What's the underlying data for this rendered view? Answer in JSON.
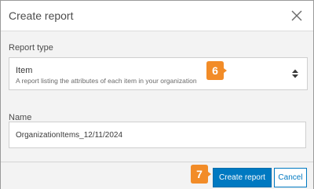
{
  "dialog": {
    "title": "Create report",
    "close_icon": "close-icon"
  },
  "report_type": {
    "label": "Report type",
    "selected_title": "Item",
    "selected_description": "A report listing the attributes of each item in your organization",
    "arrows_icon": "chevron-up-down-icon"
  },
  "name": {
    "label": "Name",
    "value": "OrganizationItems_12/11/2024"
  },
  "footer": {
    "create_label": "Create report",
    "cancel_label": "Cancel"
  },
  "callouts": {
    "report_type_step": "6",
    "create_step": "7"
  },
  "colors": {
    "accent": "#0079c1",
    "callout": "#f28c28"
  }
}
